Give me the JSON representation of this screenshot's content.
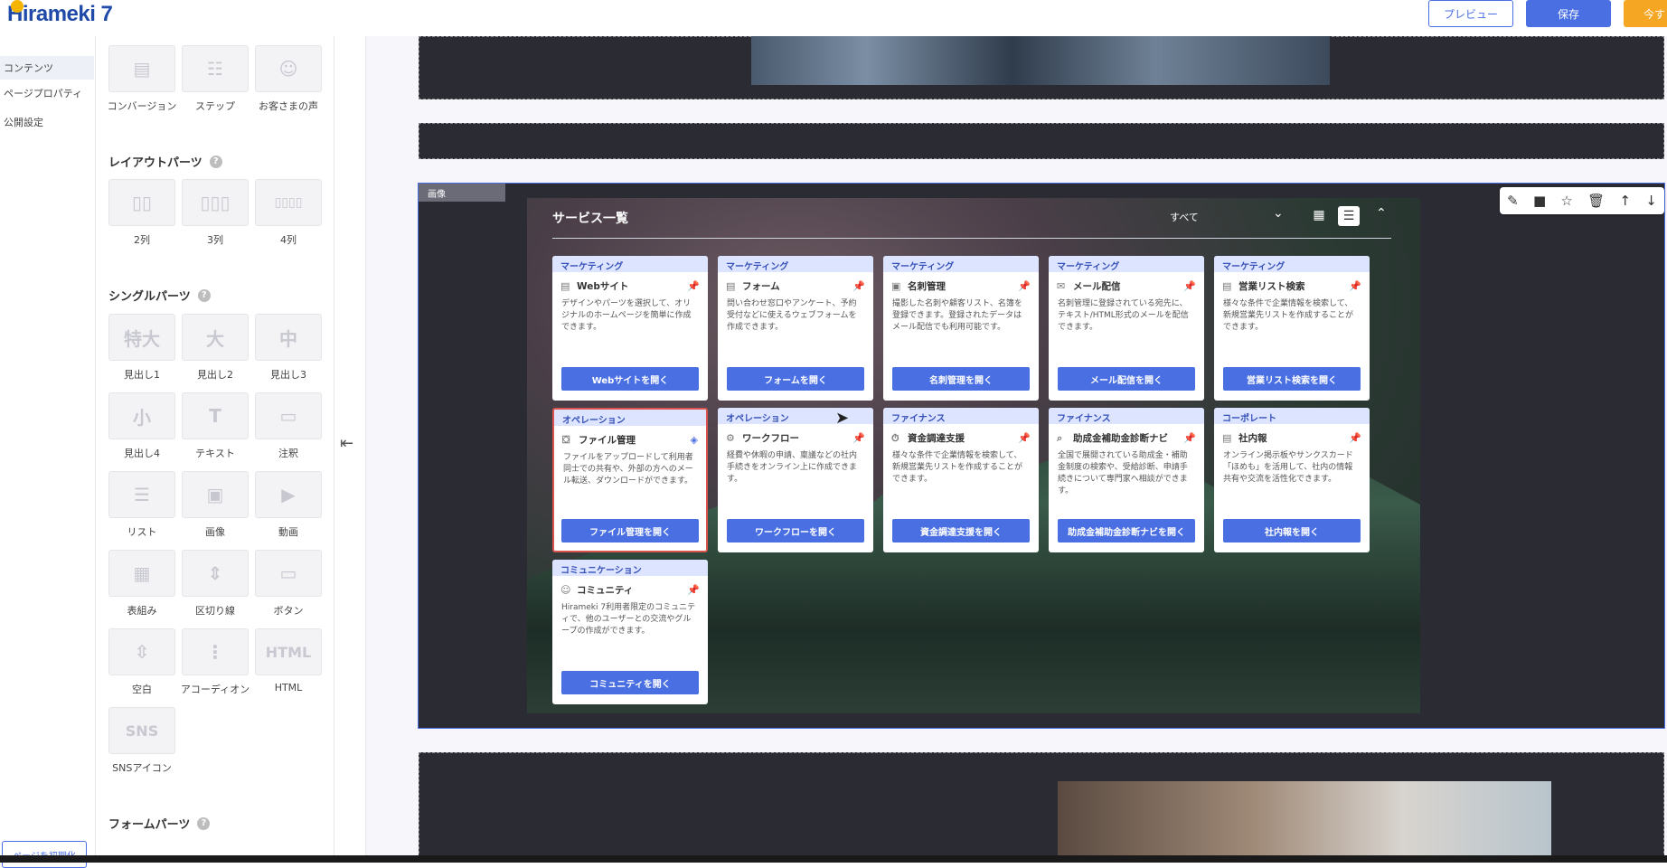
{
  "app": {
    "logo_text": "Hirameki 7"
  },
  "topbar": {
    "preview": "プレビュー",
    "save": "保存",
    "now": "今す"
  },
  "leftnav": {
    "items": [
      "コンテンツ",
      "ページプロパティ",
      "公開設定"
    ],
    "reset": "ページを初期化"
  },
  "panel": {
    "top_tiles": [
      "コンバージョン",
      "ステップ",
      "お客さまの声"
    ],
    "layout_title": "レイアウトパーツ",
    "layout_tiles": [
      "2列",
      "3列",
      "4列"
    ],
    "single_title": "シングルパーツ",
    "single_tiles": [
      {
        "label": "見出し1",
        "glyph": "特大"
      },
      {
        "label": "見出し2",
        "glyph": "大"
      },
      {
        "label": "見出し3",
        "glyph": "中"
      },
      {
        "label": "見出し4",
        "glyph": "小"
      },
      {
        "label": "テキスト",
        "glyph": "T"
      },
      {
        "label": "注釈",
        "glyph": "▭"
      },
      {
        "label": "リスト",
        "glyph": "☰"
      },
      {
        "label": "画像",
        "glyph": "▣"
      },
      {
        "label": "動画",
        "glyph": "▶"
      },
      {
        "label": "表組み",
        "glyph": "▦"
      },
      {
        "label": "区切り線",
        "glyph": "⇕"
      },
      {
        "label": "ボタン",
        "glyph": "▭"
      },
      {
        "label": "空白",
        "glyph": "⇳"
      },
      {
        "label": "アコーディオン",
        "glyph": "⋮"
      },
      {
        "label": "HTML",
        "glyph": "HTML"
      },
      {
        "label": "SNSアイコン",
        "glyph": "SNS"
      }
    ],
    "form_title": "フォームパーツ"
  },
  "image_section": {
    "tag": "画像"
  },
  "service": {
    "title": "サービス一覧",
    "filter": "すべて",
    "cards": [
      {
        "category": "マーケティング",
        "name": "Webサイト",
        "desc": "デザインやパーツを選択して、オリジナルのホームページを簡単に作成できます。",
        "button": "Webサイトを開く"
      },
      {
        "category": "マーケティング",
        "name": "フォーム",
        "desc": "問い合わせ窓口やアンケート、予約受付などに使えるウェブフォームを作成できます。",
        "button": "フォームを開く"
      },
      {
        "category": "マーケティング",
        "name": "名刺管理",
        "desc": "撮影した名刺や顧客リスト、名簿を登録できます。登録されたデータはメール配信でも利用可能です。",
        "button": "名刺管理を開く"
      },
      {
        "category": "マーケティング",
        "name": "メール配信",
        "desc": "名刺管理に登録されている宛先に、テキスト/HTML形式のメールを配信できます。",
        "button": "メール配信を開く"
      },
      {
        "category": "マーケティング",
        "name": "営業リスト検索",
        "desc": "様々な条件で企業情報を検索して、新規営業先リストを作成することができます。",
        "button": "営業リスト検索を開く"
      },
      {
        "category": "オペレーション",
        "name": "ファイル管理",
        "desc": "ファイルをアップロードして利用者同士での共有や、外部の方へのメール転送、ダウンロードができます。",
        "button": "ファイル管理を開く"
      },
      {
        "category": "オペレーション",
        "name": "ワークフロー",
        "desc": "経費や休暇の申請、稟議などの社内手続きをオンライン上に作成できます。",
        "button": "ワークフローを開く"
      },
      {
        "category": "ファイナンス",
        "name": "資金調達支援",
        "desc": "様々な条件で企業情報を検索して、新規営業先リストを作成することができます。",
        "button": "資金調達支援を開く"
      },
      {
        "category": "ファイナンス",
        "name": "助成金補助金診断ナビ",
        "desc": "全国で展開されている助成金・補助金制度の検索や、受給診断、申請手続きについて専門家へ相談ができます。",
        "button": "助成金補助金診断ナビを開く"
      },
      {
        "category": "コーポレート",
        "name": "社内報",
        "desc": "オンライン掲示板やサンクスカード「ほめも」を活用して、社内の情報共有や交流を活性化できます。",
        "button": "社内報を開く"
      },
      {
        "category": "コミュニケーション",
        "name": "コミュニティ",
        "desc": "Hirameki 7利用者限定のコミュニティで、他のユーザーとの交流やグループの作成ができます。",
        "button": "コミュニティを開く"
      }
    ]
  }
}
